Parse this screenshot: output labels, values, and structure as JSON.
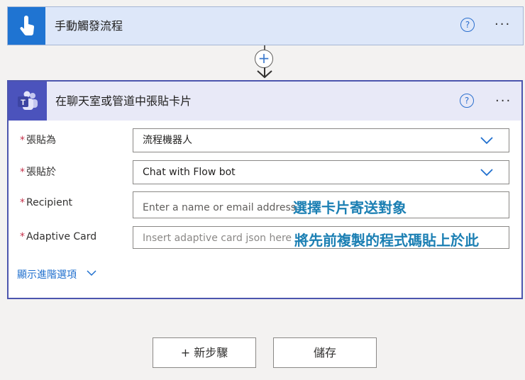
{
  "trigger": {
    "title": "手動觸發流程",
    "icon": "touch-hand-icon",
    "help": "?",
    "more": "···"
  },
  "action": {
    "title": "在聊天室或管道中張貼卡片",
    "icon": "teams-icon",
    "help": "?",
    "more": "···",
    "fields": [
      {
        "label": "張貼為",
        "required": "*",
        "value": "流程機器人",
        "type": "dropdown"
      },
      {
        "label": "張貼於",
        "required": "*",
        "value": "Chat with Flow bot",
        "type": "dropdown"
      },
      {
        "label": "Recipient",
        "required": "*",
        "placeholder": "Enter a name or email address",
        "annotation": "選擇卡片寄送對象"
      },
      {
        "label": "Adaptive Card",
        "required": "*",
        "placeholder": "Insert adaptive card json here",
        "annotation": "將先前複製的程式碼貼上於此"
      }
    ],
    "advanced_options": "顯示進階選項"
  },
  "connector": {
    "add_symbol": "+"
  },
  "buttons": {
    "new_step": "+ 新步驟",
    "save": "儲存"
  },
  "colors": {
    "trigger_tile": "#1f74d2",
    "teams_tile": "#4b53bc",
    "link": "#1f6fce",
    "annotation": "#1b7fb3",
    "required": "#c4314b"
  }
}
